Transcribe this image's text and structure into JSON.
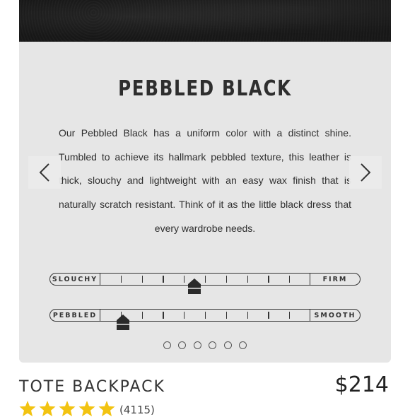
{
  "product_detail": {
    "swatch": {
      "title": "PEBBLED BLACK",
      "description": "Our Pebbled Black has a uniform color with a distinct shine. Tumbled to achieve its hallmark pebbled texture, this leather is thick, slouchy and lightweight with an easy wax finish that is naturally scratch resistant. Think of it as the little black dress that every wardrobe needs."
    },
    "scales": [
      {
        "left_label": "SLOUCHY",
        "right_label": "FIRM",
        "level": 0.45
      },
      {
        "left_label": "PEBBLED",
        "right_label": "SMOOTH",
        "level": 0.11
      }
    ],
    "carousel": {
      "dot_count": 6,
      "prev_icon": "chevron-left-icon",
      "next_icon": "chevron-right-icon"
    },
    "product": {
      "name": "TOTE BACKPACK",
      "price": "$214",
      "rating_stars": 5,
      "review_count": "(4115)"
    },
    "colors": {
      "card_bg": "#e6e6e6",
      "text": "#2e2e2e",
      "star": "#f2c311"
    }
  }
}
